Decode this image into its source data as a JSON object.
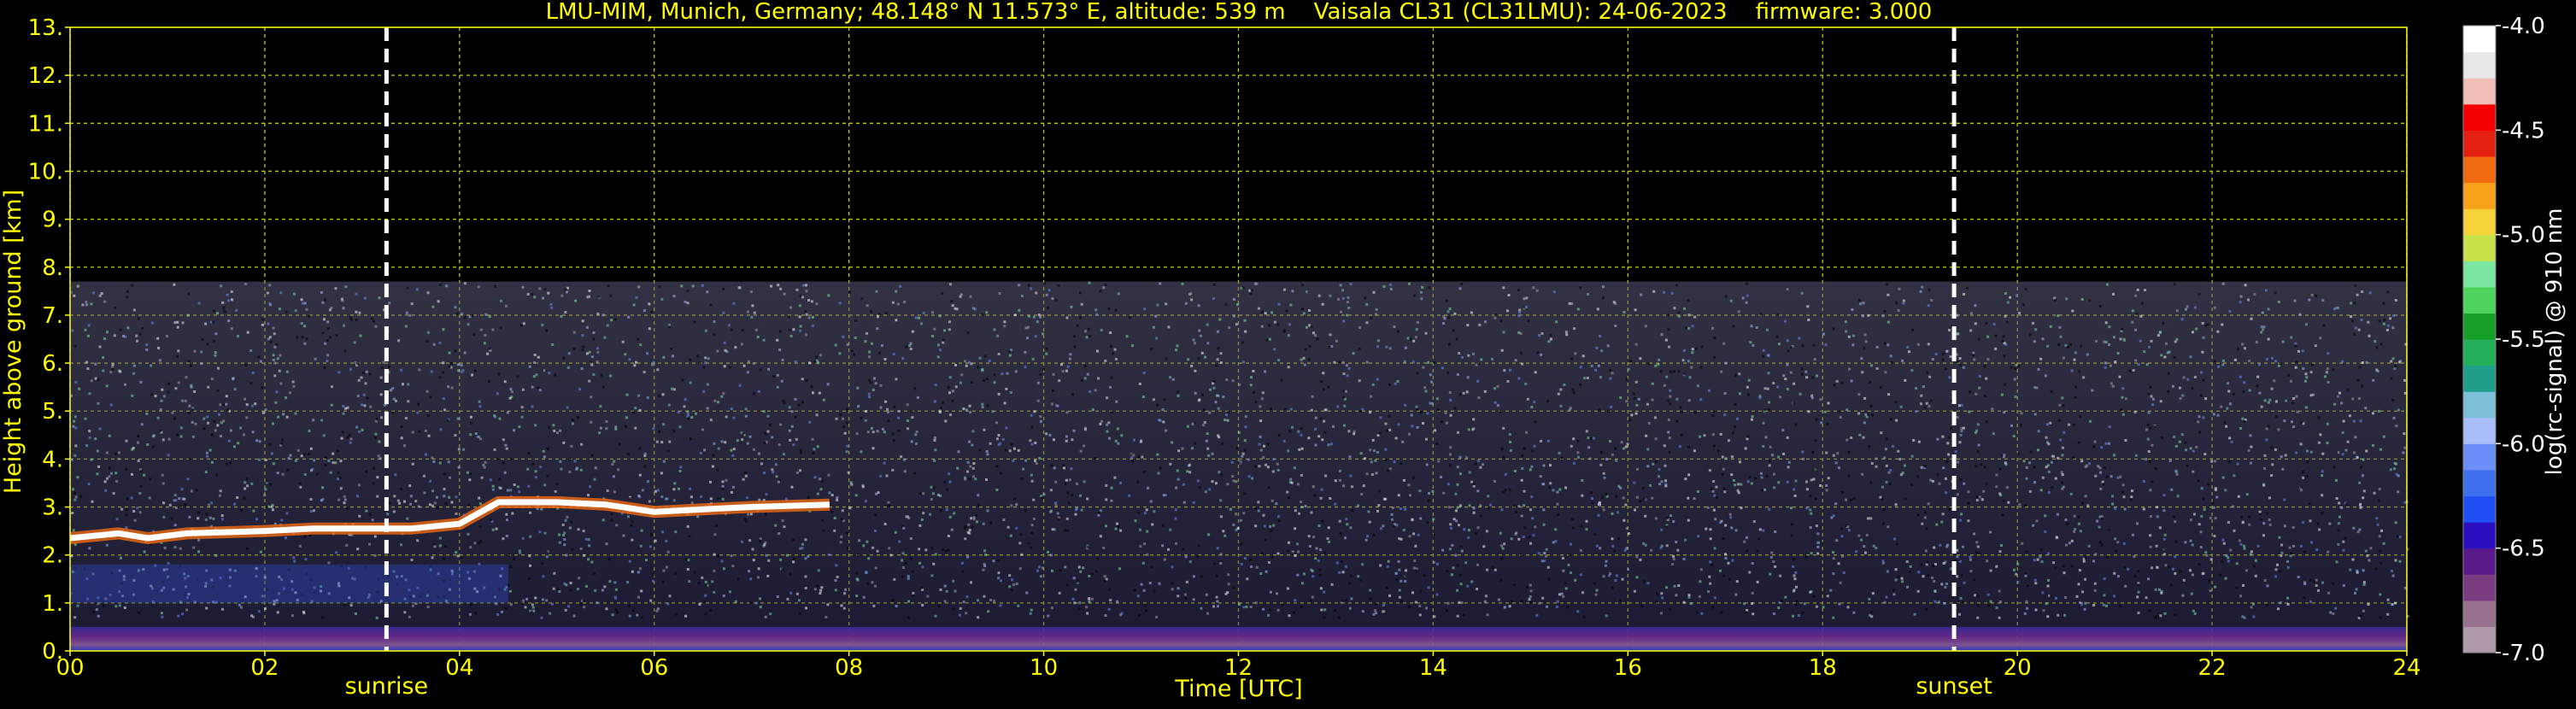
{
  "chart_data": {
    "type": "heatmap",
    "title": "LMU-MIM, Munich, Germany; 48.148° N 11.573° E, altitude: 539 m    Vaisala CL31 (CL31LMU): 24-06-2023    firmware: 3.000",
    "xlabel": "Time [UTC]",
    "ylabel": "Height above ground [km]",
    "xlim": [
      0,
      24
    ],
    "ylim": [
      0,
      13
    ],
    "x_ticks": [
      "00",
      "02",
      "04",
      "06",
      "08",
      "10",
      "12",
      "14",
      "16",
      "18",
      "20",
      "22",
      "24"
    ],
    "y_ticks": [
      "0.",
      "1.",
      "2.",
      "3.",
      "4.",
      "5.",
      "6.",
      "7.",
      "8.",
      "9.",
      "10.",
      "11.",
      "12.",
      "13."
    ],
    "grid": true,
    "annotations": [
      {
        "label": "sunrise",
        "x": 3.25
      },
      {
        "label": "sunset",
        "x": 19.35
      }
    ],
    "signal_top_km": 7.7,
    "cloud_layer": [
      {
        "x": 0.0,
        "y": 2.35
      },
      {
        "x": 0.5,
        "y": 2.45
      },
      {
        "x": 0.8,
        "y": 2.35
      },
      {
        "x": 1.2,
        "y": 2.45
      },
      {
        "x": 2.0,
        "y": 2.5
      },
      {
        "x": 2.5,
        "y": 2.55
      },
      {
        "x": 3.0,
        "y": 2.55
      },
      {
        "x": 3.5,
        "y": 2.55
      },
      {
        "x": 4.0,
        "y": 2.65
      },
      {
        "x": 4.4,
        "y": 3.1
      },
      {
        "x": 5.0,
        "y": 3.1
      },
      {
        "x": 5.5,
        "y": 3.05
      },
      {
        "x": 6.0,
        "y": 2.9
      },
      {
        "x": 6.5,
        "y": 2.95
      },
      {
        "x": 7.0,
        "y": 3.0
      },
      {
        "x": 7.8,
        "y": 3.05
      }
    ],
    "colorbar": {
      "label": "log(rc-signal) @ 910 nm",
      "ticks": [
        "-4.0",
        "-4.5",
        "-5.0",
        "-5.5",
        "-6.0",
        "-6.5",
        "-7.0"
      ],
      "range": [
        -7.0,
        -4.0
      ],
      "colors": [
        "#b09aa9",
        "#96728f",
        "#7a3c80",
        "#5a1a8a",
        "#2a10c0",
        "#1e50f5",
        "#3f6fef",
        "#6a8ef5",
        "#a9bdf9",
        "#7fc0d9",
        "#1f9f8c",
        "#24b05a",
        "#16a02a",
        "#4ed35e",
        "#7be6a0",
        "#c8e34a",
        "#f5d23a",
        "#f6a21a",
        "#f26a10",
        "#e42010",
        "#f50000",
        "#f0c0b8",
        "#e8e8e8",
        "#ffffff"
      ]
    }
  }
}
